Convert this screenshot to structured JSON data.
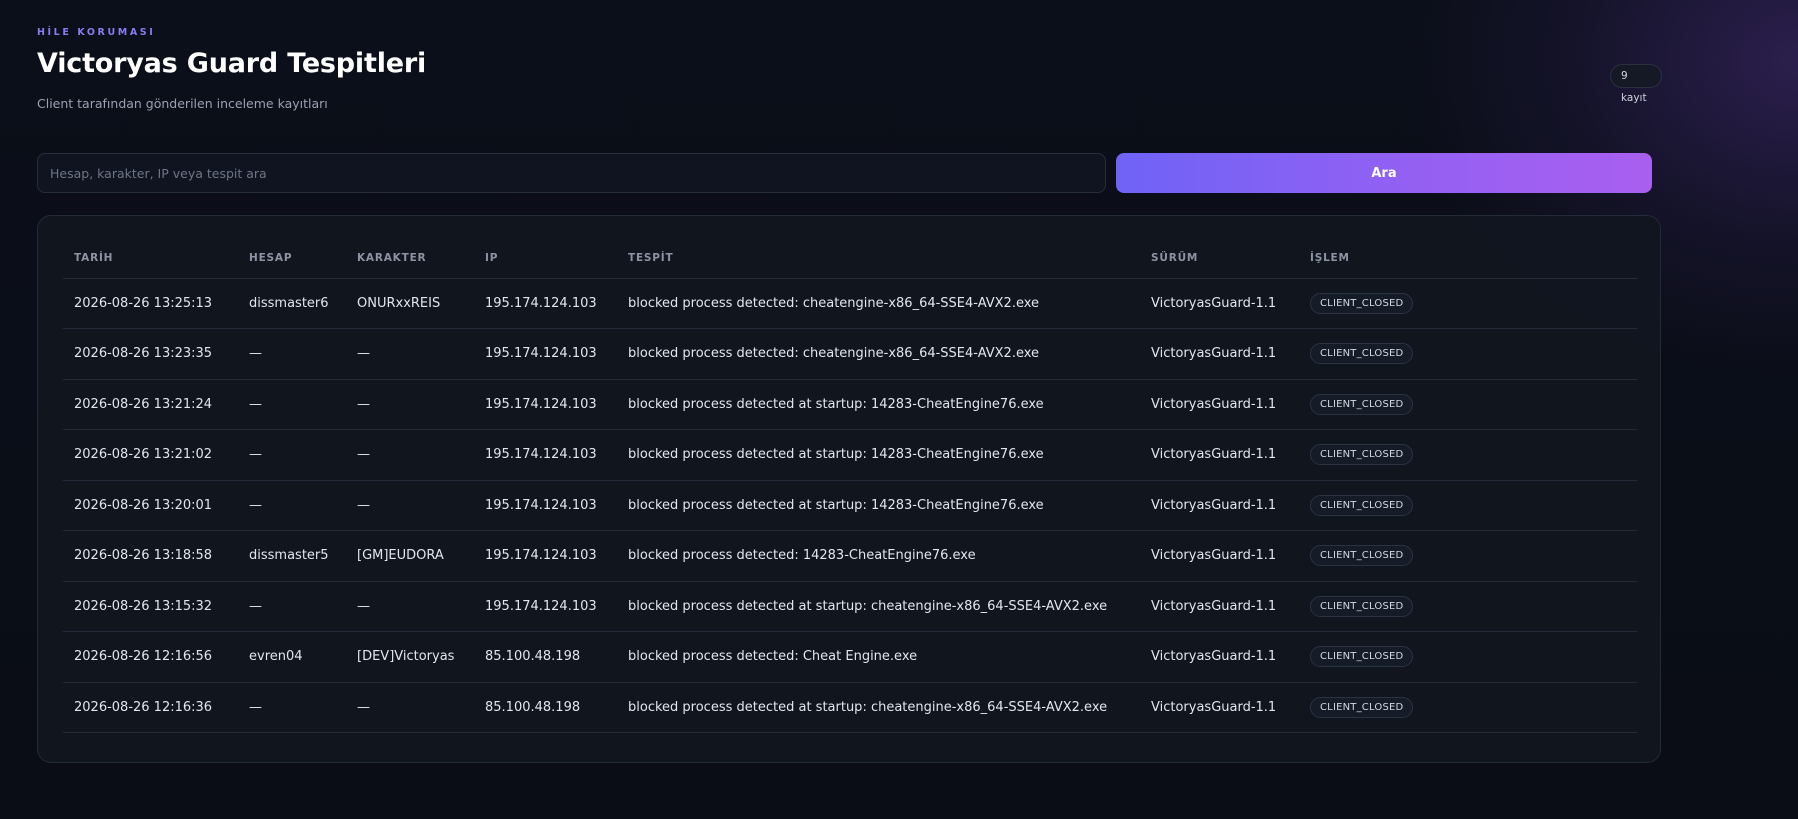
{
  "header": {
    "eyebrow": "HİLE KORUMASI",
    "title": "Victoryas Guard Tespitleri",
    "subtitle": "Client tarafından gönderilen inceleme kayıtları",
    "count_badge": "9 kayıt"
  },
  "search": {
    "placeholder": "Hesap, karakter, IP veya tespit ara",
    "value": "",
    "button_label": "Ara"
  },
  "table": {
    "columns": [
      "TARİH",
      "HESAP",
      "KARAKTER",
      "IP",
      "TESPİT",
      "SÜRÜM",
      "İŞLEM"
    ],
    "rows": [
      {
        "date": "2026-08-26 13:25:13",
        "account": "dissmaster6",
        "character": "ONURxxREIS",
        "ip": "195.174.124.103",
        "detection": "blocked process detected: cheatengine-x86_64-SSE4-AVX2.exe",
        "version": "VictoryasGuard-1.1",
        "action": "CLIENT_CLOSED"
      },
      {
        "date": "2026-08-26 13:23:35",
        "account": "—",
        "character": "—",
        "ip": "195.174.124.103",
        "detection": "blocked process detected: cheatengine-x86_64-SSE4-AVX2.exe",
        "version": "VictoryasGuard-1.1",
        "action": "CLIENT_CLOSED"
      },
      {
        "date": "2026-08-26 13:21:24",
        "account": "—",
        "character": "—",
        "ip": "195.174.124.103",
        "detection": "blocked process detected at startup: 14283-CheatEngine76.exe",
        "version": "VictoryasGuard-1.1",
        "action": "CLIENT_CLOSED"
      },
      {
        "date": "2026-08-26 13:21:02",
        "account": "—",
        "character": "—",
        "ip": "195.174.124.103",
        "detection": "blocked process detected at startup: 14283-CheatEngine76.exe",
        "version": "VictoryasGuard-1.1",
        "action": "CLIENT_CLOSED"
      },
      {
        "date": "2026-08-26 13:20:01",
        "account": "—",
        "character": "—",
        "ip": "195.174.124.103",
        "detection": "blocked process detected at startup: 14283-CheatEngine76.exe",
        "version": "VictoryasGuard-1.1",
        "action": "CLIENT_CLOSED"
      },
      {
        "date": "2026-08-26 13:18:58",
        "account": "dissmaster5",
        "character": "[GM]EUDORA",
        "ip": "195.174.124.103",
        "detection": "blocked process detected: 14283-CheatEngine76.exe",
        "version": "VictoryasGuard-1.1",
        "action": "CLIENT_CLOSED"
      },
      {
        "date": "2026-08-26 13:15:32",
        "account": "—",
        "character": "—",
        "ip": "195.174.124.103",
        "detection": "blocked process detected at startup: cheatengine-x86_64-SSE4-AVX2.exe",
        "version": "VictoryasGuard-1.1",
        "action": "CLIENT_CLOSED"
      },
      {
        "date": "2026-08-26 12:16:56",
        "account": "evren04",
        "character": "[DEV]Victoryas",
        "ip": "85.100.48.198",
        "detection": "blocked process detected: Cheat Engine.exe",
        "version": "VictoryasGuard-1.1",
        "action": "CLIENT_CLOSED"
      },
      {
        "date": "2026-08-26 12:16:36",
        "account": "—",
        "character": "—",
        "ip": "85.100.48.198",
        "detection": "blocked process detected at startup: cheatengine-x86_64-SSE4-AVX2.exe",
        "version": "VictoryasGuard-1.1",
        "action": "CLIENT_CLOSED"
      }
    ]
  }
}
